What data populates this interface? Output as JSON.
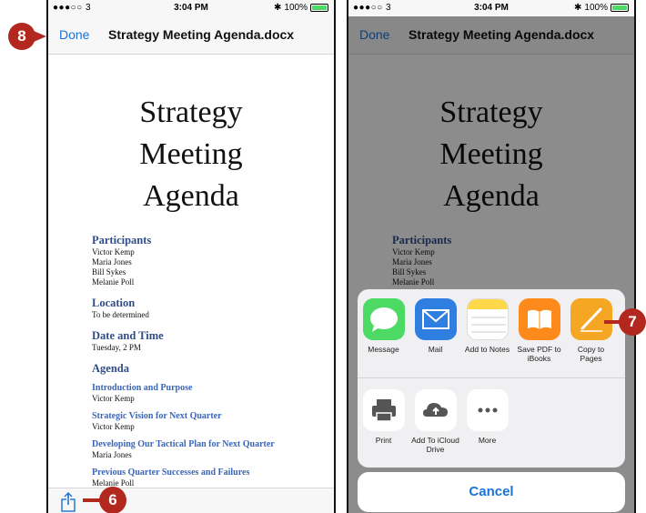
{
  "status": {
    "carrier": "●●●○○ 3",
    "time": "3:04 PM",
    "battery": "100%"
  },
  "nav": {
    "done_label": "Done",
    "title": "Strategy Meeting Agenda.docx"
  },
  "document": {
    "title_lines": [
      "Strategy",
      "Meeting",
      "Agenda"
    ],
    "participants": {
      "heading": "Participants",
      "names": [
        "Victor Kemp",
        "Maria Jones",
        "Bill Sykes",
        "Melanie Poll"
      ]
    },
    "location": {
      "heading": "Location",
      "value": "To be determined"
    },
    "date_time": {
      "heading": "Date and Time",
      "value": "Tuesday, 2 PM"
    },
    "agenda": {
      "heading": "Agenda",
      "items": [
        {
          "title": "Introduction and Purpose",
          "owner": "Victor Kemp"
        },
        {
          "title": "Strategic Vision for Next Quarter",
          "owner": "Victor Kemp"
        },
        {
          "title": "Developing Our Tactical Plan for Next Quarter",
          "owner": "Maria Jones"
        },
        {
          "title": "Previous Quarter Successes and Failures",
          "owner": "Melanie Poll"
        }
      ]
    }
  },
  "share_sheet": {
    "apps": [
      {
        "label": "Message",
        "icon": "messages-icon",
        "color": "#4cd964"
      },
      {
        "label": "Mail",
        "icon": "mail-icon",
        "color": "#2f7fe0"
      },
      {
        "label": "Add to Notes",
        "icon": "notes-icon",
        "color": "#ffd84a"
      },
      {
        "label": "Save PDF to iBooks",
        "icon": "ibooks-icon",
        "color": "#ff8a1c"
      },
      {
        "label": "Copy to Pages",
        "icon": "pages-icon",
        "color": "#f5a623"
      }
    ],
    "actions": [
      {
        "label": "Print",
        "icon": "printer-icon"
      },
      {
        "label": "Add To iCloud Drive",
        "icon": "icloud-drive-icon"
      },
      {
        "label": "More",
        "icon": "more-icon"
      }
    ],
    "cancel_label": "Cancel"
  },
  "callouts": {
    "step_6": "6",
    "step_7": "7",
    "step_8": "8"
  },
  "colors": {
    "accent": "#1a73d6",
    "heading": "#2f4d8a",
    "callout": "#b3281e"
  }
}
